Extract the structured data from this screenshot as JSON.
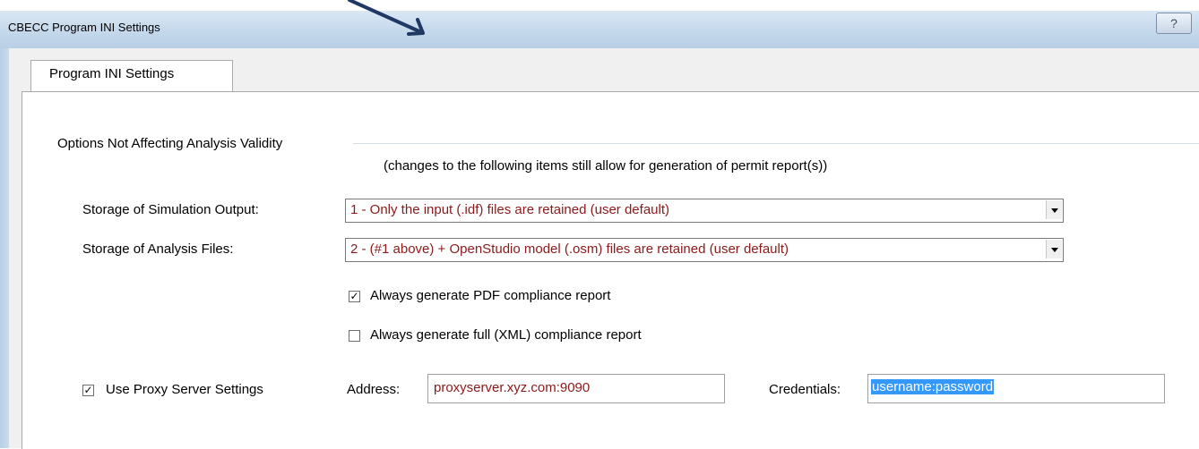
{
  "window": {
    "title": "CBECC Program INI Settings",
    "help_label": "?"
  },
  "tabs": [
    {
      "label": "Program INI Settings",
      "selected": true
    }
  ],
  "group": {
    "title": "Options Not Affecting Analysis Validity",
    "note": "(changes to the following items still allow for generation of permit report(s))"
  },
  "fields": {
    "storage_simulation_output": {
      "label": "Storage of Simulation Output:",
      "value": "1 - Only the input (.idf) files are retained (user default)"
    },
    "storage_analysis_files": {
      "label": "Storage of Analysis Files:",
      "value": "2 - (#1 above) + OpenStudio model (.osm) files are retained (user default)"
    }
  },
  "checkboxes": {
    "pdf_report": {
      "label": "Always generate PDF compliance report",
      "checked": true,
      "mark": "✓"
    },
    "xml_report": {
      "label": "Always generate full (XML) compliance report",
      "checked": false,
      "mark": ""
    },
    "proxy": {
      "label": "Use Proxy Server Settings",
      "checked": true,
      "mark": "✓"
    }
  },
  "proxy": {
    "address_label": "Address:",
    "address_value": "proxyserver.xyz.com:9090",
    "credentials_label": "Credentials:",
    "credentials_value": "username:password"
  },
  "colors": {
    "value_text": "#8b1a1a",
    "selection": "#3399ff",
    "annotation_arrow": "#1f3864"
  },
  "icons": [
    "annotation-arrow-icon",
    "help-icon",
    "dropdown-arrow-icon",
    "checkbox-checked-icon",
    "checkbox-unchecked-icon"
  ]
}
